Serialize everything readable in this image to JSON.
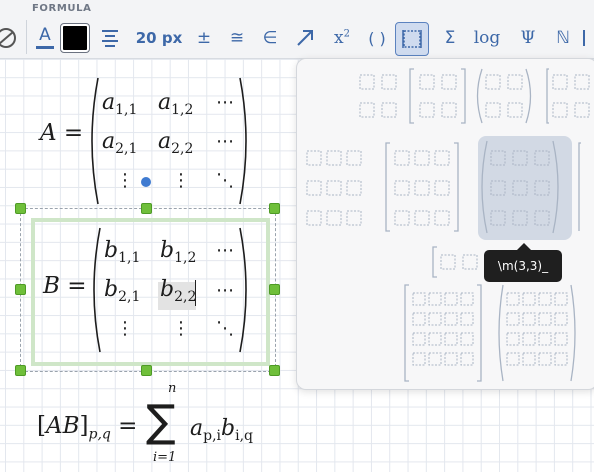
{
  "toolbar": {
    "section_label": "FORMULA",
    "font_size": "20 px",
    "colors": {
      "text_accent": "#3d68a8",
      "swatch": "#000000"
    },
    "tools": [
      {
        "name": "text-color-icon",
        "glyph": "A"
      },
      {
        "name": "fill-color-swatch",
        "glyph": ""
      },
      {
        "name": "align-icon",
        "glyph": "≡"
      },
      {
        "name": "plus-minus-icon",
        "glyph": "±"
      },
      {
        "name": "approx-equal-icon",
        "glyph": "≅"
      },
      {
        "name": "element-of-icon",
        "glyph": "∈"
      },
      {
        "name": "arrow-icon",
        "glyph": "↗"
      },
      {
        "name": "superscript-icon",
        "glyph": "x²"
      },
      {
        "name": "parentheses-icon",
        "glyph": "( )"
      },
      {
        "name": "matrix-icon",
        "glyph": ""
      },
      {
        "name": "sum-icon",
        "glyph": "Σ"
      },
      {
        "name": "log-icon",
        "glyph": "log"
      },
      {
        "name": "psi-icon",
        "glyph": "Ψ"
      },
      {
        "name": "naturals-icon",
        "glyph": "ℕ"
      }
    ]
  },
  "formulas": {
    "matrix_a": {
      "lhs": "A",
      "entries": [
        [
          "a",
          "1,1"
        ],
        [
          "a",
          "1,2"
        ],
        [
          "a",
          "2,1"
        ],
        [
          "a",
          "2,2"
        ]
      ]
    },
    "matrix_b": {
      "lhs": "B",
      "entries": [
        [
          "b",
          "1,1"
        ],
        [
          "b",
          "1,2"
        ],
        [
          "b",
          "2,1"
        ],
        [
          "b",
          "2,2"
        ]
      ]
    },
    "product": {
      "lhs": "[AB]",
      "lhs_sub": "p,q",
      "sum_top": "n",
      "sum_bottom": "i=1",
      "term1": "a",
      "term1_sub": "p,i",
      "term2": "b",
      "term2_sub": "i,q"
    }
  },
  "panel": {
    "tooltip": "\\m(3,3)_",
    "highlight_color": "#d2d9e4"
  }
}
